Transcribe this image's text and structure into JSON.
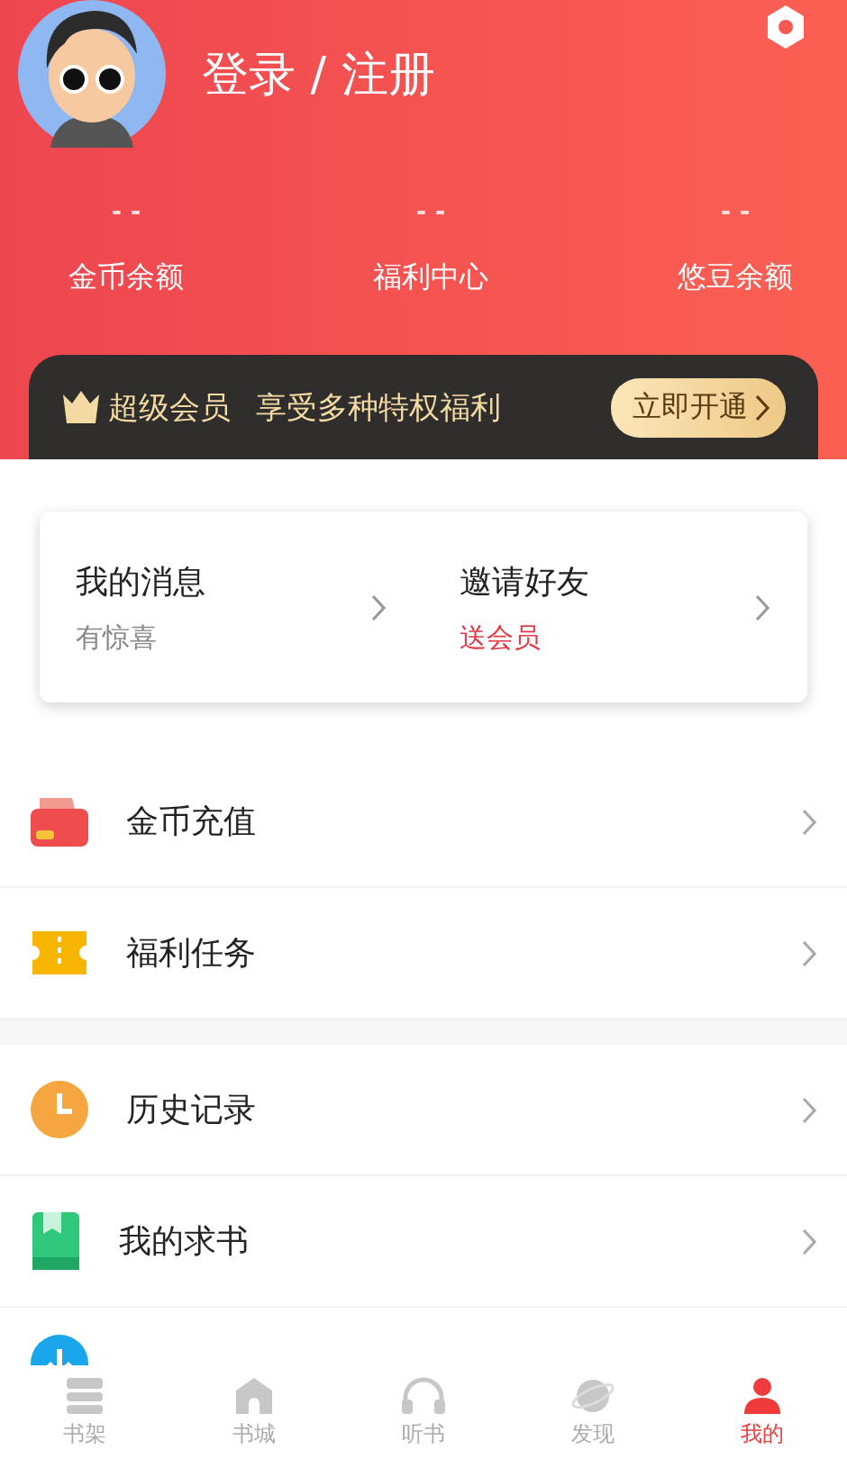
{
  "header": {
    "title": "登录 / 注册"
  },
  "stats": [
    {
      "value": "- -",
      "label": "金币余额"
    },
    {
      "value": "- -",
      "label": "福利中心"
    },
    {
      "value": "- -",
      "label": "悠豆余额"
    }
  ],
  "vip_bar": {
    "title": "超级会员",
    "subtitle": "享受多种特权福利",
    "button": "立即开通"
  },
  "quick_card": [
    {
      "title": "我的消息",
      "subtitle": "有惊喜",
      "highlight": false
    },
    {
      "title": "邀请好友",
      "subtitle": "送会员",
      "highlight": true
    }
  ],
  "menu_groups": [
    [
      {
        "kind": "wallet",
        "label": "金币充值"
      },
      {
        "kind": "ticket",
        "label": "福利任务"
      }
    ],
    [
      {
        "kind": "clock",
        "label": "历史记录"
      },
      {
        "kind": "book",
        "label": "我的求书"
      },
      {
        "kind": "download"
      }
    ]
  ],
  "tab_bar": [
    {
      "kind": "shelf",
      "label": "书架",
      "selected": false
    },
    {
      "kind": "store",
      "label": "书城",
      "selected": false
    },
    {
      "kind": "audio",
      "label": "听书",
      "selected": false
    },
    {
      "kind": "discover",
      "label": "发现",
      "selected": false
    },
    {
      "kind": "me",
      "label": "我的",
      "selected": true
    }
  ]
}
